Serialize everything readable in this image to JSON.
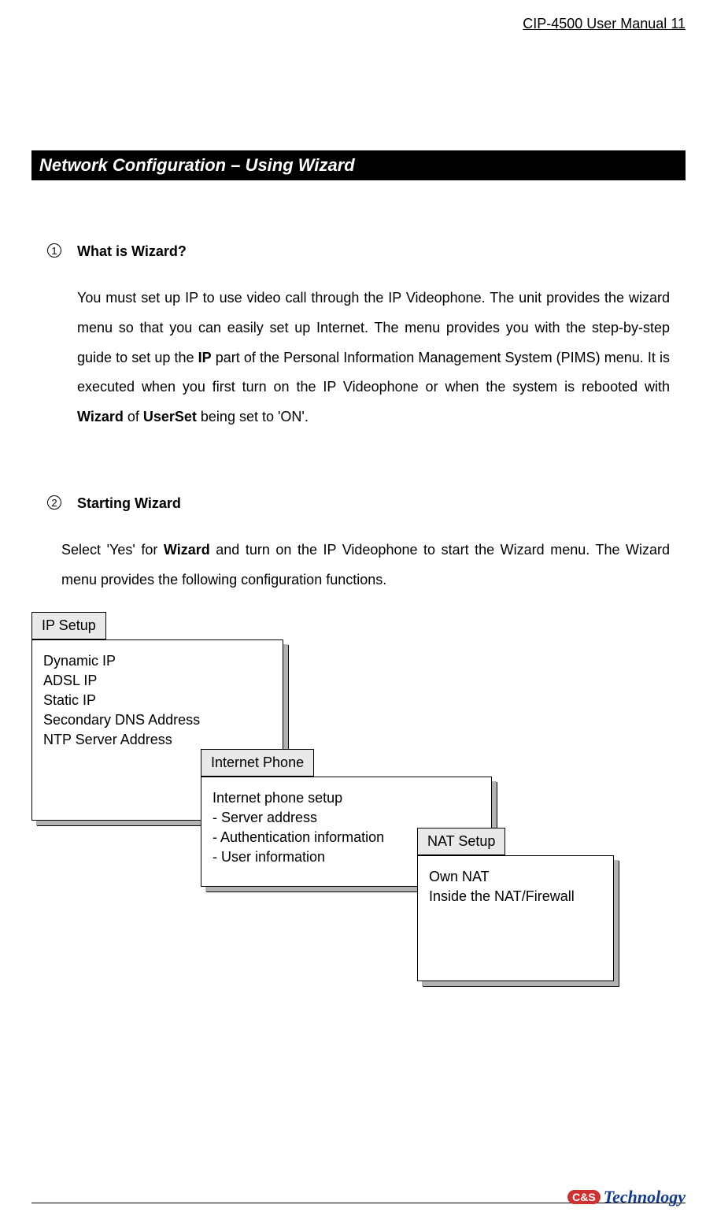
{
  "header": {
    "doc_title": "CIP-4500 User Manual",
    "page_number": "11"
  },
  "section": {
    "title": "Network Configuration – Using Wizard"
  },
  "items": [
    {
      "marker": "1",
      "heading": "What is Wizard?",
      "body_1": "You must set up IP to use video call through the IP Videophone. The unit provides the wizard menu so that you can easily set up Internet. The menu provides you with the step-by-step guide to set up the ",
      "bold_1": "IP",
      "body_2": " part of the Personal Information Management System (PIMS) menu. It is executed when you first turn on the IP Videophone or when the system is rebooted with ",
      "bold_2": "Wizard",
      "body_3": " of ",
      "bold_3": "UserSet",
      "body_4": " being set to 'ON'."
    },
    {
      "marker": "2",
      "heading": "Starting Wizard",
      "body_1": "Select 'Yes' for ",
      "bold_1": "Wizard",
      "body_2": " and turn on the IP Videophone to start the Wizard menu. The Wizard menu provides the following configuration functions."
    }
  ],
  "diagram": {
    "box1": {
      "label": "IP Setup",
      "lines": [
        "Dynamic IP",
        "ADSL IP",
        "Static IP",
        "Secondary DNS Address",
        "NTP Server Address"
      ]
    },
    "box2": {
      "label": "Internet Phone",
      "lines": [
        "Internet phone setup",
        "- Server address",
        "- Authentication information",
        "- User information"
      ]
    },
    "box3": {
      "label": "NAT Setup",
      "lines": [
        "Own NAT",
        "Inside the NAT/Firewall"
      ]
    }
  },
  "logo": {
    "badge": "C&S",
    "text": "Technology"
  }
}
